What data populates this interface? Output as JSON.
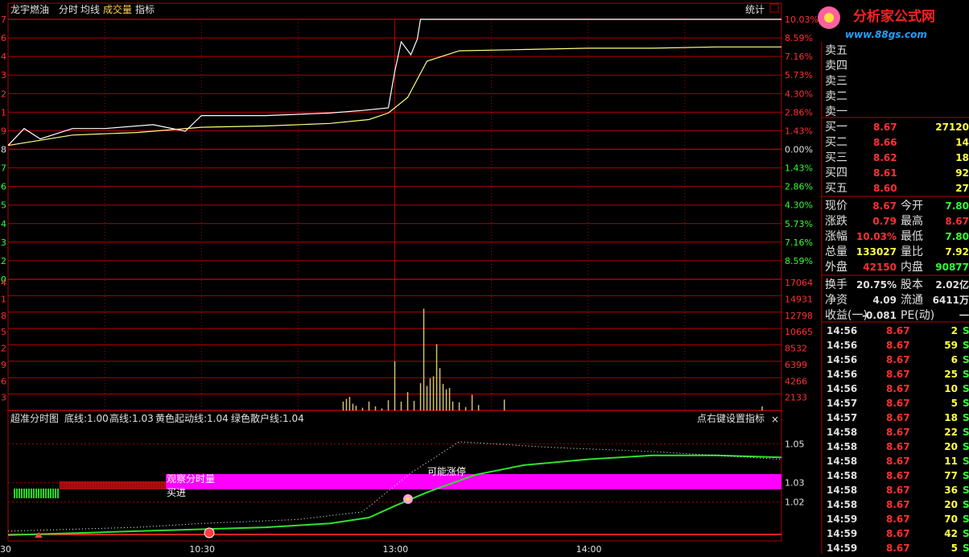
{
  "toolbar": {
    "stock_name": "龙宇燃油",
    "tabs": [
      "分时",
      "均线",
      "成交量",
      "指标"
    ],
    "stats_label": "统计"
  },
  "colors": {
    "grid": "#b00000",
    "price_line": "#ffffff",
    "avg_line": "#ffff80",
    "up": "#ff3030",
    "down": "#30ff30",
    "volume": "#d4c070",
    "accent": "#ff00ff"
  },
  "price_axis": {
    "right_upper": [
      "10.03%",
      "8.59%",
      "7.16%",
      "5.73%",
      "4.30%",
      "2.86%",
      "1.43%"
    ],
    "zero": "0.00%",
    "right_lower": [
      "1.43%",
      "2.86%",
      "4.30%",
      "5.73%",
      "7.16%",
      "8.59%"
    ],
    "left_digits": [
      "7",
      "6",
      "4",
      "3",
      "2",
      "1",
      "9",
      "8",
      "7",
      "6",
      "5",
      "4",
      "3",
      "2",
      "0"
    ]
  },
  "volume_axis": {
    "ticks": [
      "17064",
      "14931",
      "12798",
      "10665",
      "8532",
      "6399",
      "4266",
      "2133"
    ],
    "left_digits": [
      "4",
      "1",
      "8",
      "5",
      "2",
      "9",
      "6",
      "3"
    ]
  },
  "indicator": {
    "title": "超准分时图",
    "params": [
      "底线:1.00",
      "高线:1.03",
      "黄色起动线:1.04",
      "绿色散户线:1.04"
    ],
    "hint": "点右键设置指标",
    "close_icon": "×",
    "ticks": [
      "1.05",
      "1.03",
      "1.02"
    ],
    "labels": {
      "observe": "观察分时量",
      "buy": "买进",
      "limit": "可能涨停"
    }
  },
  "time_axis": [
    "30",
    "10:30",
    "13:00",
    "14:00"
  ],
  "logo": {
    "text": "分析家公式网",
    "url": "www.88gs.com"
  },
  "order_book": {
    "asks": [
      {
        "label": "卖五"
      },
      {
        "label": "卖四"
      },
      {
        "label": "卖三"
      },
      {
        "label": "卖二"
      },
      {
        "label": "卖一"
      }
    ],
    "bids": [
      {
        "label": "买一",
        "price": "8.67",
        "vol": "27120"
      },
      {
        "label": "买二",
        "price": "8.66",
        "vol": "14"
      },
      {
        "label": "买三",
        "price": "8.62",
        "vol": "18"
      },
      {
        "label": "买四",
        "price": "8.61",
        "vol": "92"
      },
      {
        "label": "买五",
        "price": "8.60",
        "vol": "27"
      }
    ]
  },
  "quote": [
    {
      "l1": "现价",
      "v1": "8.67",
      "c1": "#ff3030",
      "l2": "今开",
      "v2": "7.80",
      "c2": "#30ff30"
    },
    {
      "l1": "涨跌",
      "v1": "0.79",
      "c1": "#ff3030",
      "l2": "最高",
      "v2": "8.67",
      "c2": "#ff3030"
    },
    {
      "l1": "涨幅",
      "v1": "10.03%",
      "c1": "#ff3030",
      "l2": "最低",
      "v2": "7.80",
      "c2": "#30ff30"
    },
    {
      "l1": "总量",
      "v1": "133027",
      "c1": "#ffff40",
      "l2": "量比",
      "v2": "7.92",
      "c2": "#ffff40"
    },
    {
      "l1": "外盘",
      "v1": "42150",
      "c1": "#ff3030",
      "l2": "内盘",
      "v2": "90877",
      "c2": "#30ff30"
    }
  ],
  "fundamentals": [
    {
      "l1": "换手",
      "v1": "20.75%",
      "l2": "股本",
      "v2": "2.02亿"
    },
    {
      "l1": "净资",
      "v1": "4.09",
      "l2": "流通",
      "v2": "6411万"
    },
    {
      "l1": "收益(一)",
      "v1": "-0.081",
      "l2": "PE(动)",
      "v2": "一"
    }
  ],
  "ticks": [
    {
      "time": "14:56",
      "price": "8.67",
      "vol": "2",
      "side": "S"
    },
    {
      "time": "14:56",
      "price": "8.67",
      "vol": "59",
      "side": "S"
    },
    {
      "time": "14:56",
      "price": "8.67",
      "vol": "6",
      "side": "S"
    },
    {
      "time": "14:56",
      "price": "8.67",
      "vol": "25",
      "side": "S"
    },
    {
      "time": "14:56",
      "price": "8.67",
      "vol": "10",
      "side": "S"
    },
    {
      "time": "14:57",
      "price": "8.67",
      "vol": "5",
      "side": "S"
    },
    {
      "time": "14:57",
      "price": "8.67",
      "vol": "18",
      "side": "S"
    },
    {
      "time": "14:58",
      "price": "8.67",
      "vol": "22",
      "side": "S"
    },
    {
      "time": "14:58",
      "price": "8.67",
      "vol": "20",
      "side": "S"
    },
    {
      "time": "14:58",
      "price": "8.67",
      "vol": "11",
      "side": "S"
    },
    {
      "time": "14:58",
      "price": "8.67",
      "vol": "77",
      "side": "S"
    },
    {
      "time": "14:58",
      "price": "8.67",
      "vol": "36",
      "side": "S"
    },
    {
      "time": "14:58",
      "price": "8.67",
      "vol": "20",
      "side": "S"
    },
    {
      "time": "14:59",
      "price": "8.67",
      "vol": "70",
      "side": "S"
    },
    {
      "time": "14:59",
      "price": "8.67",
      "vol": "42",
      "side": "S"
    },
    {
      "time": "14:59",
      "price": "8.67",
      "vol": "5",
      "side": "S"
    }
  ],
  "chart_data": [
    {
      "type": "line",
      "name": "intraday-price",
      "x_range": [
        "09:30",
        "15:00"
      ],
      "ylim_pct": [
        -10.03,
        10.03
      ],
      "series": [
        {
          "x": [
            0,
            5,
            10,
            20,
            30,
            45,
            55,
            60,
            70,
            80,
            90,
            100,
            110,
            118,
            120,
            122,
            125,
            127,
            128,
            130,
            135,
            145,
            160,
            180,
            200,
            220,
            240
          ],
          "values": [
            0.3,
            1.6,
            0.8,
            1.6,
            1.6,
            1.9,
            1.4,
            2.6,
            2.6,
            2.6,
            2.7,
            2.8,
            3.0,
            3.2,
            6.0,
            8.3,
            7.3,
            8.5,
            10.03,
            10.03,
            10.03,
            10.03,
            10.03,
            10.03,
            10.03,
            10.03,
            10.03
          ]
        },
        {
          "x": [
            0,
            20,
            40,
            60,
            80,
            100,
            112,
            118,
            124,
            130,
            140,
            160,
            180,
            200,
            220,
            240
          ],
          "values": [
            0.3,
            1.1,
            1.3,
            1.7,
            1.8,
            2.0,
            2.3,
            2.8,
            4.0,
            6.8,
            7.6,
            7.7,
            7.8,
            7.8,
            7.9,
            7.9
          ]
        }
      ]
    },
    {
      "type": "bar",
      "name": "intraday-volume",
      "ylim": [
        0,
        19197
      ],
      "x": [
        104,
        105,
        106,
        107,
        108,
        110,
        112,
        114,
        116,
        118,
        120,
        122,
        124,
        126,
        128,
        129,
        130,
        131,
        132,
        133,
        134,
        135,
        136,
        137,
        138,
        140,
        142,
        144,
        146,
        154,
        234
      ],
      "values": [
        1300,
        1700,
        2000,
        1000,
        700,
        400,
        1300,
        600,
        300,
        1500,
        7200,
        1300,
        2700,
        1400,
        4000,
        14900,
        3600,
        4700,
        5000,
        9700,
        6200,
        3900,
        3100,
        3300,
        1300,
        1200,
        500,
        2300,
        800,
        1600,
        600
      ]
    },
    {
      "type": "line",
      "name": "indicator",
      "ylim": [
        1.0,
        1.058
      ],
      "series": [
        {
          "x": [
            0,
            40,
            80,
            100,
            112,
            120,
            130,
            145,
            160,
            180,
            200,
            220,
            240
          ],
          "values": [
            1.003,
            1.005,
            1.007,
            1.009,
            1.012,
            1.018,
            1.025,
            1.034,
            1.039,
            1.042,
            1.044,
            1.044,
            1.043
          ]
        },
        {
          "x": [
            0,
            40,
            60,
            90,
            110,
            125,
            140,
            150,
            170,
            200,
            220,
            240
          ],
          "values": [
            1.005,
            1.007,
            1.009,
            1.011,
            1.015,
            1.035,
            1.051,
            1.05,
            1.048,
            1.046,
            1.044,
            1.042
          ]
        }
      ]
    }
  ]
}
